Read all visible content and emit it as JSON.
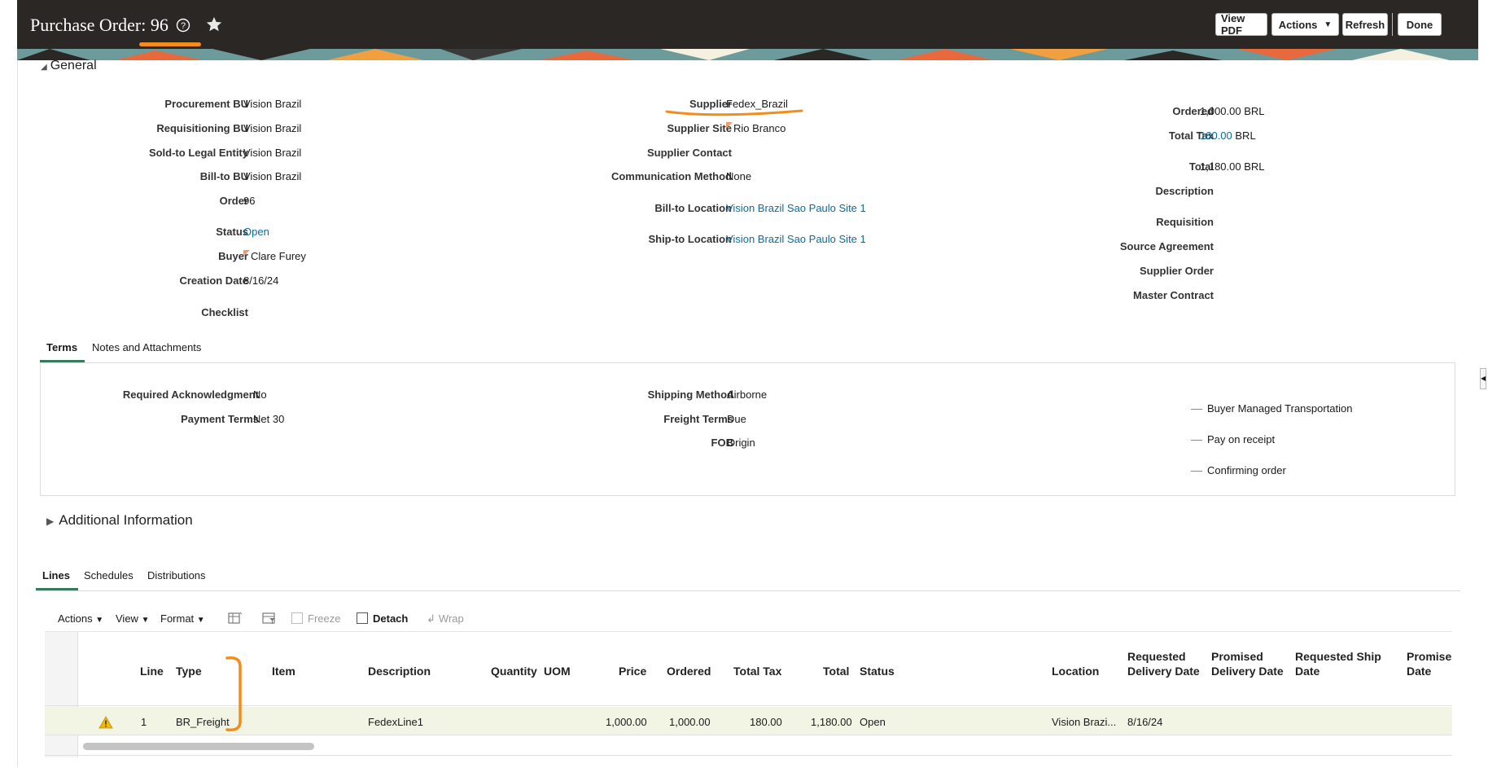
{
  "header": {
    "title": "Purchase Order: 96",
    "help_icon": "question-circle-icon",
    "favorite_icon": "star-icon",
    "buttons": {
      "view_pdf": "View PDF",
      "actions": "Actions",
      "refresh": "Refresh",
      "done": "Done"
    },
    "annotation_color": "#f28c1b"
  },
  "general": {
    "section_title": "General",
    "col1": [
      {
        "label": "Procurement BU",
        "value": "Vision Brazil"
      },
      {
        "label": "Requisitioning BU",
        "value": "Vision Brazil"
      },
      {
        "label": "Sold-to Legal Entity",
        "value": "Vision Brazil"
      },
      {
        "label": "Bill-to BU",
        "value": "Vision Brazil"
      },
      {
        "label": "Order",
        "value": "96"
      },
      {
        "label": "Status",
        "value": "Open"
      },
      {
        "label": "Buyer",
        "value": "Clare Furey"
      },
      {
        "label": "Creation Date",
        "value": "8/16/24"
      },
      {
        "label": "Checklist",
        "value": ""
      }
    ],
    "col2": [
      {
        "label": "Supplier",
        "value": "Fedex_Brazil"
      },
      {
        "label": "Supplier Site",
        "value": "Rio Branco"
      },
      {
        "label": "Supplier Contact",
        "value": ""
      },
      {
        "label": "Communication Method",
        "value": "None"
      },
      {
        "label": "Bill-to Location",
        "value": "Vision Brazil Sao Paulo Site 1"
      },
      {
        "label": "Ship-to Location",
        "value": "Vision Brazil Sao Paulo Site 1"
      }
    ],
    "col3": [
      {
        "label": "Ordered",
        "value": "1,000.00 BRL"
      },
      {
        "label": "Total Tax",
        "value": "180.00",
        "suffix": "BRL"
      },
      {
        "label": "Total",
        "value": "1,180.00 BRL"
      },
      {
        "label": "Description",
        "value": ""
      },
      {
        "label": "Requisition",
        "value": ""
      },
      {
        "label": "Source Agreement",
        "value": ""
      },
      {
        "label": "Supplier Order",
        "value": ""
      },
      {
        "label": "Master Contract",
        "value": ""
      }
    ]
  },
  "terms": {
    "tabs": [
      "Terms",
      "Notes and Attachments"
    ],
    "col1": [
      {
        "label": "Required Acknowledgment",
        "value": "No"
      },
      {
        "label": "Payment Terms",
        "value": "Net 30"
      }
    ],
    "col2": [
      {
        "label": "Shipping Method",
        "value": "Airborne"
      },
      {
        "label": "Freight Terms",
        "value": "Due"
      },
      {
        "label": "FOB",
        "value": "Origin"
      }
    ],
    "checks": [
      "Buyer Managed Transportation",
      "Pay on receipt",
      "Confirming order"
    ]
  },
  "additional_info": {
    "title": "Additional Information"
  },
  "lines": {
    "tabs": [
      "Lines",
      "Schedules",
      "Distributions"
    ],
    "toolbar": {
      "actions": "Actions",
      "view": "View",
      "format": "Format",
      "freeze": "Freeze",
      "detach": "Detach",
      "wrap": "Wrap"
    },
    "columns": [
      "Line",
      "Type",
      "Item",
      "Description",
      "Quantity",
      "UOM",
      "Price",
      "Ordered",
      "Total Tax",
      "Total",
      "Status",
      "Location",
      "Requested Delivery Date",
      "Promised Delivery Date",
      "Requested Ship Date",
      "Promise Date"
    ],
    "column_lines": {
      "req_delivery": [
        "Requested",
        "Delivery Date"
      ],
      "prom_delivery": [
        "Promised",
        "Delivery Date"
      ],
      "req_ship": [
        "Requested Ship",
        "Date"
      ],
      "promise": [
        "Promise",
        "Date"
      ]
    },
    "rows": [
      {
        "line": "1",
        "type": "BR_Freight",
        "item": "",
        "description": "FedexLine1",
        "quantity": "",
        "uom": "",
        "price": "1,000.00",
        "ordered": "1,000.00",
        "total_tax": "180.00",
        "total": "1,180.00",
        "status": "Open",
        "location": "Vision Brazi...",
        "requested_delivery_date": "8/16/24",
        "promised_delivery_date": "",
        "requested_ship_date": "",
        "promise_date": ""
      }
    ],
    "row_icon": "warning-icon"
  }
}
